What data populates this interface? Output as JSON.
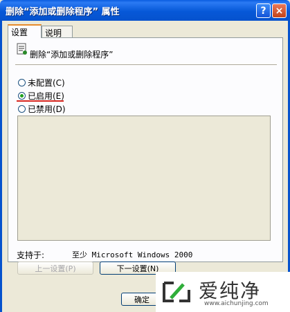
{
  "window": {
    "title": "删除“添加或删除程序” 属性",
    "help_label": "?",
    "close_label": "×"
  },
  "tabs": [
    {
      "label": "设置",
      "active": true
    },
    {
      "label": "说明",
      "active": false
    }
  ],
  "policy": {
    "name": "删除“添加或删除程序”",
    "icon": "policy-setting-icon"
  },
  "options": [
    {
      "label": "未配置(C)",
      "selected": false
    },
    {
      "label": "已启用(E)",
      "selected": true
    },
    {
      "label": "已禁用(D)",
      "selected": false
    }
  ],
  "support": {
    "label": "支持于:",
    "value": "至少 Microsoft Windows 2000"
  },
  "buttons": {
    "prev": "上一设置(P)",
    "next": "下一设置(N)",
    "ok": "确定"
  },
  "watermark": {
    "text": "爱纯净",
    "url": "www.aichunjing.com"
  },
  "colors": {
    "titlebar": "#0552cd",
    "annotation_underline": "#d8261f",
    "radio_dot": "#21a121"
  }
}
